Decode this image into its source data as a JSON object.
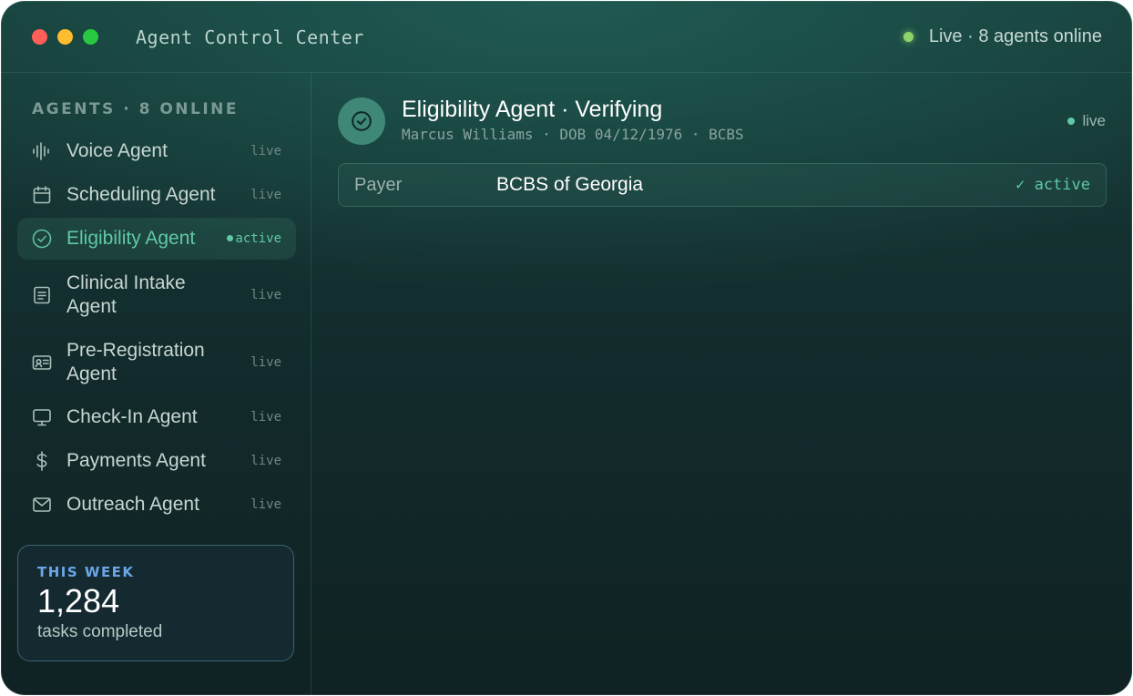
{
  "window": {
    "title": "Agent Control Center",
    "status_text": "Live · 8 agents online"
  },
  "sidebar": {
    "section_title": "AGENTS · 8 ONLINE",
    "items": [
      {
        "label": "Voice Agent",
        "state": "live",
        "icon": "waveform-icon"
      },
      {
        "label": "Scheduling Agent",
        "state": "live",
        "icon": "calendar-icon"
      },
      {
        "label": "Eligibility Agent",
        "state": "active",
        "icon": "check-circle-icon"
      },
      {
        "label": "Clinical Intake Agent",
        "state": "live",
        "icon": "document-list-icon"
      },
      {
        "label": "Pre-Registration Agent",
        "state": "live",
        "icon": "id-card-icon"
      },
      {
        "label": "Check-In Agent",
        "state": "live",
        "icon": "monitor-icon"
      },
      {
        "label": "Payments Agent",
        "state": "live",
        "icon": "dollar-icon"
      },
      {
        "label": "Outreach Agent",
        "state": "live",
        "icon": "envelope-icon"
      }
    ],
    "stats": {
      "kicker": "THIS WEEK",
      "value": "1,284",
      "caption": "tasks completed"
    }
  },
  "main": {
    "title": "Eligibility Agent · Verifying",
    "subtitle": "Marcus Williams · DOB 04/12/1976 · BCBS",
    "status": "live",
    "fields": [
      {
        "key": "Payer",
        "value": "BCBS of Georgia",
        "status": "✓ active"
      }
    ]
  },
  "colors": {
    "accent": "#5fc9a4",
    "live_dot": "#8fd46a",
    "stats_kicker": "#6aa6e8"
  }
}
